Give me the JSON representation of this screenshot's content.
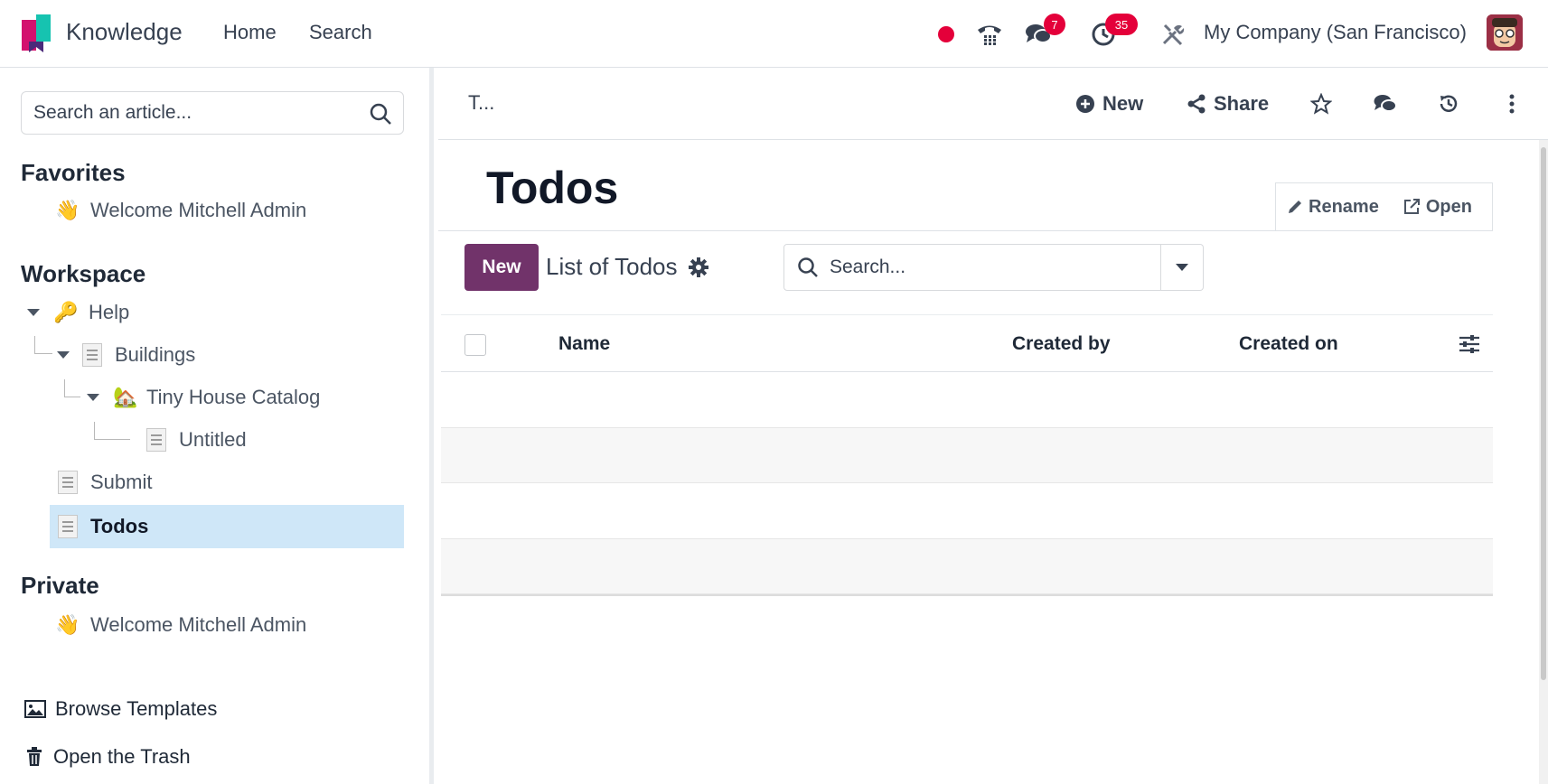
{
  "navbar": {
    "app_name": "Knowledge",
    "links": [
      "Home",
      "Search"
    ],
    "messages_badge": "7",
    "activities_badge": "35",
    "company": "My Company (San Francisco)",
    "icons": [
      "recording-dot",
      "phone-icon",
      "chat-icon",
      "clock-icon",
      "tools-icon",
      "avatar"
    ]
  },
  "sidebar": {
    "search_placeholder": "Search an article...",
    "favorites_title": "Favorites",
    "favorites": [
      {
        "emoji": "👋",
        "label": "Welcome Mitchell Admin"
      }
    ],
    "workspace_title": "Workspace",
    "workspace": [
      {
        "emoji": "🔑",
        "label": "Help",
        "expanded": true
      },
      {
        "label": "Buildings",
        "expanded": true
      },
      {
        "emoji": "🏡",
        "label": "Tiny House Catalog",
        "expanded": true
      },
      {
        "label": "Untitled"
      },
      {
        "label": "Submit"
      },
      {
        "label": "Todos",
        "active": true
      }
    ],
    "private_title": "Private",
    "private": [
      {
        "emoji": "👋",
        "label": "Welcome Mitchell Admin"
      }
    ],
    "browse_templates": "Browse Templates",
    "open_trash": "Open the Trash"
  },
  "main": {
    "breadcrumb": "T...",
    "toolbar": {
      "new_label": "New",
      "share_label": "Share"
    },
    "title": "Todos",
    "embed": {
      "rename_label": "Rename",
      "open_label": "Open",
      "new_button": "New",
      "list_title": "List of Todos",
      "search_placeholder": "Search...",
      "columns": [
        "Name",
        "Created by",
        "Created on"
      ],
      "empty_rows": 4
    }
  },
  "colors": {
    "primary": "#71336a",
    "badge": "#e4003a",
    "active_row": "#cfe7f8"
  }
}
